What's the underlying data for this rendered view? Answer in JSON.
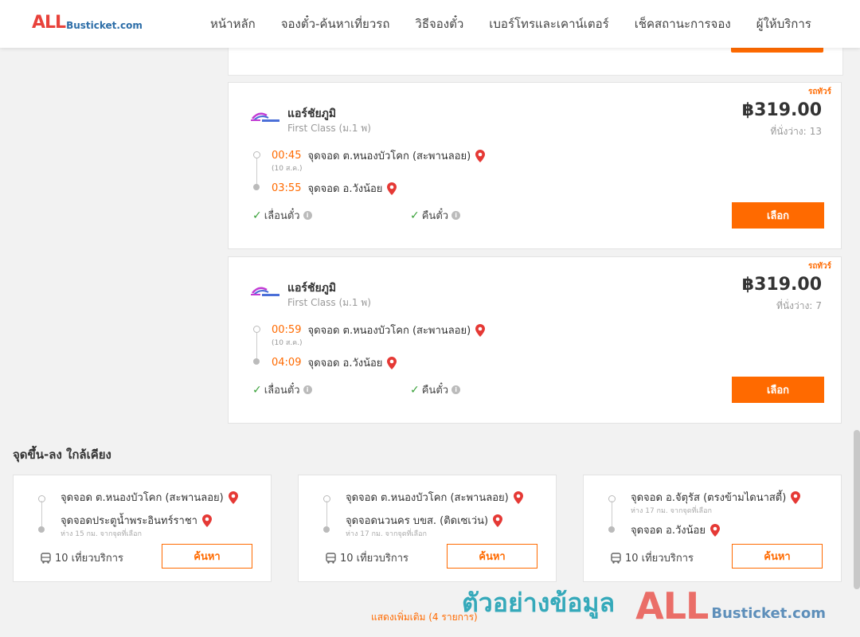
{
  "header": {
    "logo_all": "ALL",
    "logo_rest": "Busticket.com",
    "nav": [
      {
        "label": "หน้าหลัก"
      },
      {
        "label": "จองตั๋ว-ค้นหาเที่ยวรถ"
      },
      {
        "label": "วิธีจองตั๋ว"
      },
      {
        "label": "เบอร์โทรและเคาน์เตอร์"
      },
      {
        "label": "เช็คสถานะการจอง"
      },
      {
        "label": "ผู้ให้บริการ"
      }
    ]
  },
  "trips": [
    {
      "promo": "รถทัวร์",
      "operator": "แอร์ชัยภูมิ",
      "bus_class": "First Class (ม.1 พ)",
      "price": "฿319.00",
      "seats_label": "ที่นั่งว่าง:",
      "seats": "13",
      "depart_time": "00:45",
      "depart_stop": "จุดจอด ต.หนองบัวโคก (สะพานลอย)",
      "depart_date": "(10 ส.ค.)",
      "arrive_time": "03:55",
      "arrive_stop": "จุดจอด อ.วังน้อย",
      "feature_1": "เลื่อนตั๋ว",
      "feature_2": "คืนตั๋ว",
      "select_label": "เลือก"
    },
    {
      "promo": "รถทัวร์",
      "operator": "แอร์ชัยภูมิ",
      "bus_class": "First Class (ม.1 พ)",
      "price": "฿319.00",
      "seats_label": "ที่นั่งว่าง:",
      "seats": "7",
      "depart_time": "00:59",
      "depart_stop": "จุดจอด ต.หนองบัวโคก (สะพานลอย)",
      "depart_date": "(10 ส.ค.)",
      "arrive_time": "04:09",
      "arrive_stop": "จุดจอด อ.วังน้อย",
      "feature_1": "เลื่อนตั๋ว",
      "feature_2": "คืนตั๋ว",
      "select_label": "เลือก"
    }
  ],
  "nearby": {
    "title": "จุดขึ้น-ลง ใกล้เคียง",
    "cards": [
      {
        "from": "จุดจอด ต.หนองบัวโคก (สะพานลอย)",
        "to": "จุดจอดประตูน้ำพระอินทร์ราชา",
        "to_distance": "ห่าง 15 กม. จากจุดที่เลือก",
        "trips": "10 เที่ยวบริการ",
        "search_label": "ค้นหา"
      },
      {
        "from": "จุดจอด ต.หนองบัวโคก (สะพานลอย)",
        "to": "จุดจอดนวนคร บขส. (ติดเซเว่น)",
        "to_distance": "ห่าง 17 กม. จากจุดที่เลือก",
        "trips": "10 เที่ยวบริการ",
        "search_label": "ค้นหา"
      },
      {
        "from": "จุดจอด อ.จัตุรัส (ตรงข้ามไดนาสตี้)",
        "from_distance": "ห่าง 17 กม. จากจุดที่เลือก",
        "to": "จุดจอด อ.วังน้อย",
        "trips": "10 เที่ยวบริการ",
        "search_label": "ค้นหา"
      }
    ],
    "show_more": "แสดงเพิ่มเติม (4 รายการ)"
  },
  "watermark": {
    "text": "ตัวอย่างข้อมูล",
    "all": "ALL",
    "rest": "Busticket.com"
  },
  "colors": {
    "accent": "#ff6a00",
    "brand_red": "#e8423b",
    "brand_blue": "#2d6ea8",
    "watermark_teal": "#2ba6b8"
  }
}
